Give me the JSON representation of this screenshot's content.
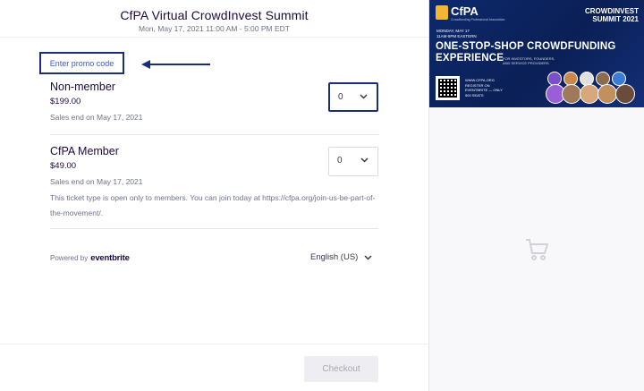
{
  "header": {
    "title": "CfPA Virtual CrowdInvest Summit",
    "date": "Mon, May 17, 2021 11:00 AM - 5:00 PM EDT"
  },
  "promo": {
    "label": "Enter promo code"
  },
  "tickets": [
    {
      "name": "Non-member",
      "price": "$199.00",
      "sales_end": "Sales end on May 17, 2021",
      "quantity": "0"
    },
    {
      "name": "CfPA Member",
      "price": "$49.00",
      "sales_end": "Sales end on May 17, 2021",
      "note": "This ticket type is open only to members. You can join today at https://cfpa.org/join-us-be-part-of-the-movement/.",
      "quantity": "0"
    }
  ],
  "footer": {
    "powered_by": "Powered by",
    "brand": "eventbrite",
    "language": "English (US)",
    "checkout_label": "Checkout"
  },
  "banner": {
    "logo": "CfPA",
    "tagline": "Crowdfunding Professional Association",
    "summit_line1": "CROWDINVEST",
    "summit_line2": "SUMMIT 2021",
    "when_line1": "MONDAY, MAY 17",
    "when_line2": "11AM-5PM EASTERN",
    "headline_line1": "ONE-STOP-SHOP CROWDFUNDING",
    "headline_line2": "EXPERIENCE",
    "sub_line1": "FOR INVESTORS, FOUNDERS,",
    "sub_line2": "AND SERVICE PROVIDERS",
    "register_line1": "WWW.CFPA.ORG",
    "register_line2": "REGISTER ON",
    "register_line3": "EVENTBRITE — ONLY",
    "register_line4": "500 SEATS"
  },
  "colors": {
    "accent_border": "#1c2d7a",
    "link": "#3659e3",
    "banner_bg": "#0d2a6e"
  },
  "icons": {
    "close": "close-icon",
    "arrow": "arrow-left-icon",
    "chevron": "chevron-down-icon",
    "cart": "shopping-cart-icon"
  }
}
